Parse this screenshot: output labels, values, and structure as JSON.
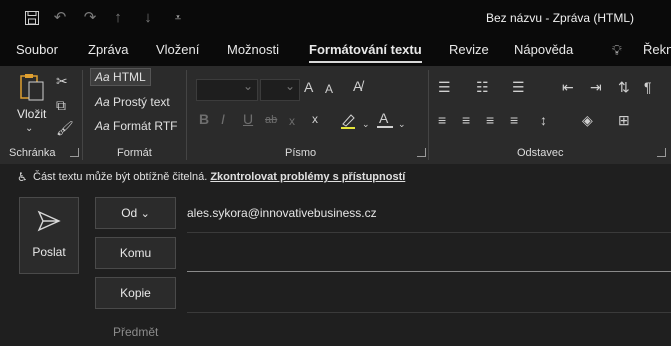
{
  "window": {
    "title": "Bez názvu  -  Zpráva (HTML)"
  },
  "quick_access": [
    "save-icon",
    "undo-icon",
    "redo-icon",
    "up-arrow-icon",
    "down-arrow-icon",
    "customize-icon"
  ],
  "tabs": [
    {
      "label": "Soubor"
    },
    {
      "label": "Zpráva"
    },
    {
      "label": "Vložení"
    },
    {
      "label": "Možnosti"
    },
    {
      "label": "Formátování textu",
      "active": true
    },
    {
      "label": "Revize"
    },
    {
      "label": "Nápověda"
    },
    {
      "label": "Řekn"
    }
  ],
  "ribbon": {
    "clipboard": {
      "label": "Schránka",
      "paste": "Vložit"
    },
    "format": {
      "label": "Formát",
      "html": "HTML",
      "plain": "Prostý text",
      "rtf": "Formát RTF",
      "aa": "Aa"
    },
    "font": {
      "label": "Písmo",
      "size_up": "A",
      "size_down": "A",
      "bold": "B",
      "italic": "I",
      "underline": "U",
      "strike": "ab",
      "sub": "x",
      "sup": "x"
    },
    "paragraph": {
      "label": "Odstavec"
    }
  },
  "infobar": {
    "text": "Část textu může být obtížně čitelná.",
    "link": "Zkontrolovat problémy s přístupností"
  },
  "compose": {
    "send": "Poslat",
    "from_label": "Od",
    "from_value": "ales.sykora@innovativebusiness.cz",
    "to_label": "Komu",
    "cc_label": "Kopie",
    "subject_placeholder": "Předmět"
  }
}
